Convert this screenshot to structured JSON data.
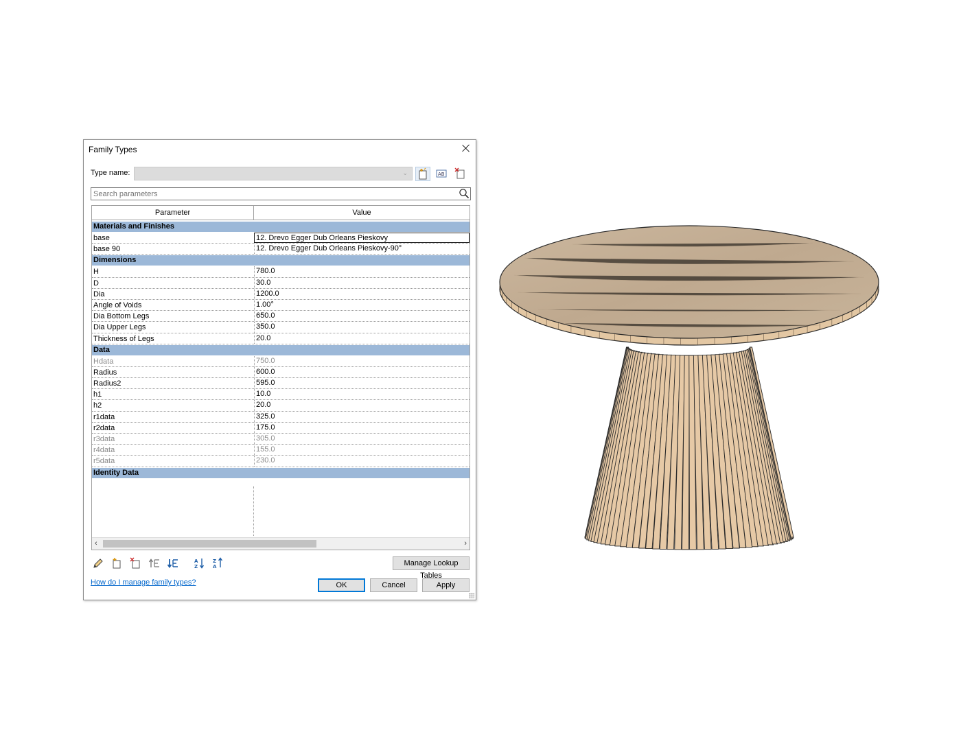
{
  "dialog": {
    "title": "Family Types",
    "type_name_label": "Type name:",
    "type_name_value": "",
    "search_placeholder": "Search parameters",
    "columns": {
      "parameter": "Parameter",
      "value": "Value"
    },
    "groups": [
      {
        "name": "Materials and Finishes",
        "rows": [
          {
            "parameter": "base",
            "value": "12. Drevo Egger Dub Orleans Pieskovy"
          },
          {
            "parameter": "base 90",
            "value": "12. Drevo Egger Dub Orleans Pieskovy-90°"
          }
        ]
      },
      {
        "name": "Dimensions",
        "rows": [
          {
            "parameter": "H",
            "value": "780.0"
          },
          {
            "parameter": "D",
            "value": "30.0"
          },
          {
            "parameter": "Dia",
            "value": "1200.0"
          },
          {
            "parameter": "Angle of Voids",
            "value": "1.00°"
          },
          {
            "parameter": "Dia Bottom Legs",
            "value": "650.0"
          },
          {
            "parameter": "Dia Upper Legs",
            "value": "350.0"
          },
          {
            "parameter": "Thickness of Legs",
            "value": "20.0"
          }
        ]
      },
      {
        "name": "Data",
        "rows": [
          {
            "parameter": "Hdata",
            "value": "750.0"
          },
          {
            "parameter": "Radius",
            "value": "600.0"
          },
          {
            "parameter": "Radius2",
            "value": "595.0"
          },
          {
            "parameter": "h1",
            "value": "10.0"
          },
          {
            "parameter": "h2",
            "value": "20.0"
          },
          {
            "parameter": "r1data",
            "value": "325.0"
          },
          {
            "parameter": "r2data",
            "value": "175.0"
          },
          {
            "parameter": "r3data",
            "value": "305.0"
          },
          {
            "parameter": "r4data",
            "value": "155.0"
          },
          {
            "parameter": "r5data",
            "value": "230.0"
          }
        ]
      },
      {
        "name": "Identity Data",
        "rows": []
      }
    ],
    "manage_lookup_label": "Manage Lookup Tables",
    "help_link": "How do I manage family types?",
    "ok_label": "OK",
    "cancel_label": "Cancel",
    "apply_label": "Apply"
  },
  "icons": {
    "toolbar": [
      "new-type-icon",
      "rename-type-icon",
      "delete-type-icon"
    ],
    "bottom": [
      "edit-parameter-icon",
      "new-parameter-icon",
      "delete-parameter-icon",
      "move-up-icon",
      "move-down-icon",
      "sort-ascending-icon",
      "sort-descending-icon"
    ]
  },
  "colors": {
    "group_header": "#9cb8d8",
    "ok_border": "#0078d7",
    "link": "#0066cc",
    "wood_top": "#c2ad93",
    "slat": "#e6c9a6"
  }
}
